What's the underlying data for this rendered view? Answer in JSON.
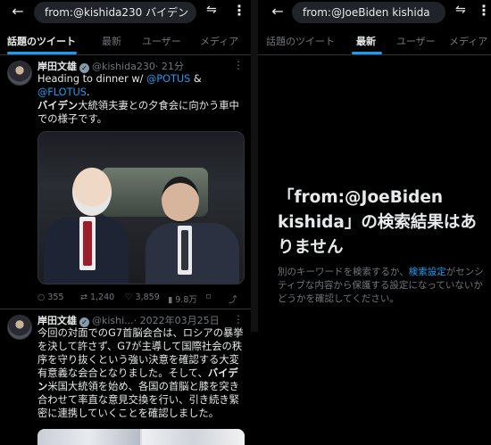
{
  "left": {
    "search_text": "from:@kishida230 バイデン",
    "tabs": [
      {
        "label": "話題のツイート",
        "active": true
      },
      {
        "label": "最新",
        "active": false
      },
      {
        "label": "ユーザー",
        "active": false
      },
      {
        "label": "メディア",
        "active": false
      }
    ],
    "tweet1": {
      "name": "岸田文雄",
      "handle": "@kishida230",
      "time": "· 21分",
      "text_pre": "Heading to dinner w/ ",
      "mention1": "@POTUS",
      "text_amp": " &",
      "mention2": "@FLOTUS",
      "text_dot": ".",
      "jp_bold": "バイデン",
      "jp_rest": "大統領夫妻との夕食会に向かう車中での様子です。",
      "replies": "355",
      "retweets": "1,240",
      "likes": "3,859",
      "views": "9.8万"
    },
    "tweet2": {
      "name": "岸田文雄",
      "handle": "@kishi...",
      "time": "· 2022年03月25日",
      "text_a": "今回の対面でのG7首脳会合は、ロシアの暴挙を決して許さず、G7が主導して国際社会の秩序を守り抜くという強い決意を確認する大変有意義な会合となりました。そして、",
      "bold": "バイデン",
      "text_b": "米国大統領を始め、各国の首脳と膝を突き合わせて率直な意見交換を行い、引き続き緊密に連携していくことを確認しました。"
    }
  },
  "right": {
    "search_text": "from:@JoeBiden kishida",
    "tabs": [
      {
        "label": "話題のツイート",
        "active": false
      },
      {
        "label": "最新",
        "active": true
      },
      {
        "label": "ユーザー",
        "active": false
      },
      {
        "label": "メディア",
        "active": false
      }
    ],
    "empty_title": "「from:@JoeBiden kishida」の検索結果はありません",
    "empty_desc_pre": "別のキーワードを検索するか、",
    "empty_desc_link": "検索設定",
    "empty_desc_post": "がセンシティブな内容から保護する設定になっていないかどうかを確認してください。"
  },
  "icons": {
    "back": "←",
    "tune": "⚙",
    "kebab": "⋮",
    "reply": "○",
    "retweet": "⇄",
    "like": "♡",
    "views": "▮",
    "share": "⤴"
  },
  "colors": {
    "accent": "#1d9bf0",
    "background": "#000000",
    "muted": "#71767b"
  }
}
